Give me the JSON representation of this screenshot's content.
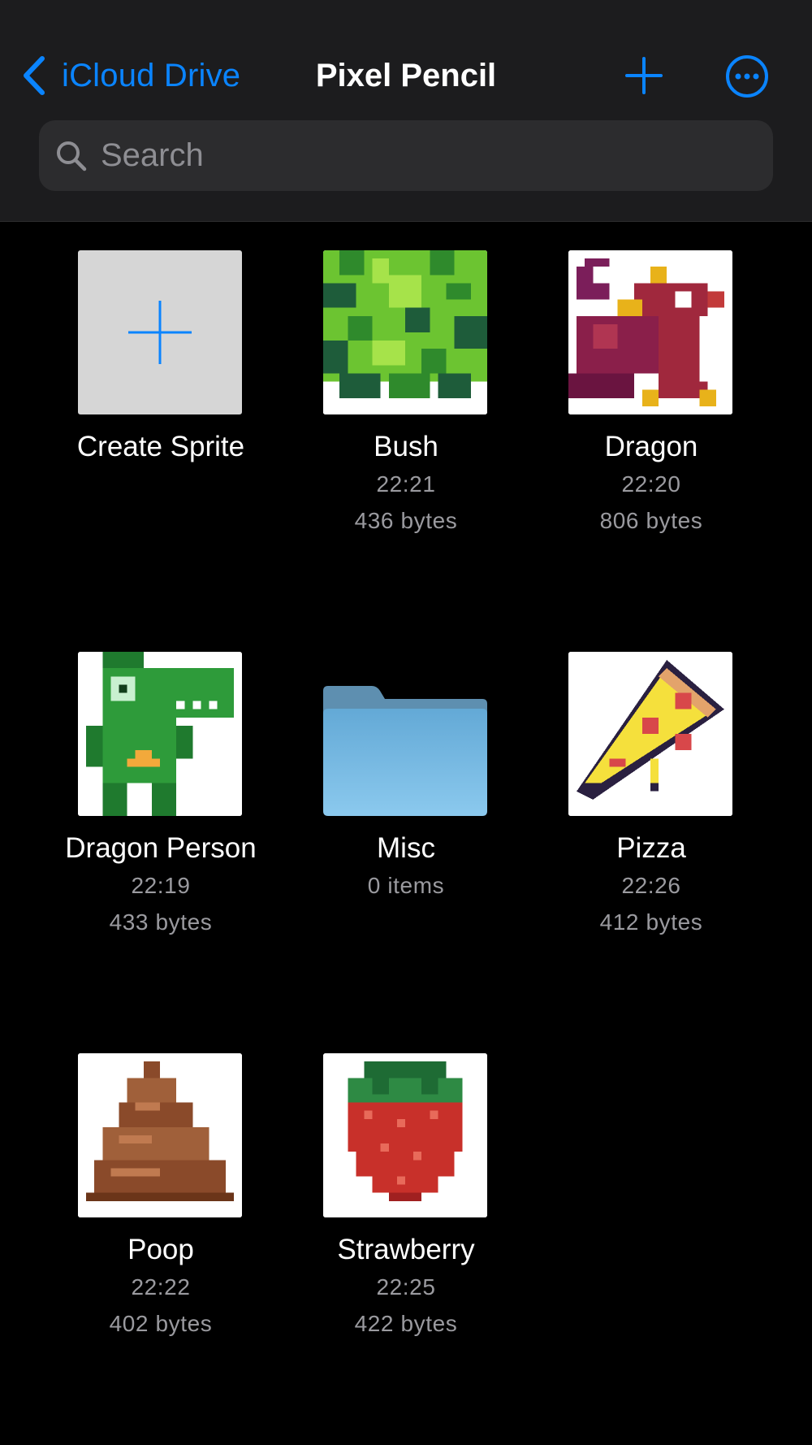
{
  "nav": {
    "back_label": "iCloud Drive",
    "title": "Pixel Pencil"
  },
  "search": {
    "placeholder": "Search"
  },
  "colors": {
    "accent": "#0a84ff",
    "header_bg": "#1c1c1e",
    "background": "#000000",
    "secondary_text": "#9a9a9f"
  },
  "items": [
    {
      "label": "Create Sprite",
      "icon": "plus-icon"
    },
    {
      "label": "Bush",
      "time": "22:21",
      "size": "436 bytes"
    },
    {
      "label": "Dragon",
      "time": "22:20",
      "size": "806 bytes"
    },
    {
      "label": "Dragon Person",
      "time": "22:19",
      "size": "433 bytes"
    },
    {
      "label": "Misc",
      "count": "0 items",
      "icon": "folder-icon"
    },
    {
      "label": "Pizza",
      "time": "22:26",
      "size": "412 bytes"
    },
    {
      "label": "Poop",
      "time": "22:22",
      "size": "402 bytes"
    },
    {
      "label": "Strawberry",
      "time": "22:25",
      "size": "422 bytes"
    }
  ]
}
